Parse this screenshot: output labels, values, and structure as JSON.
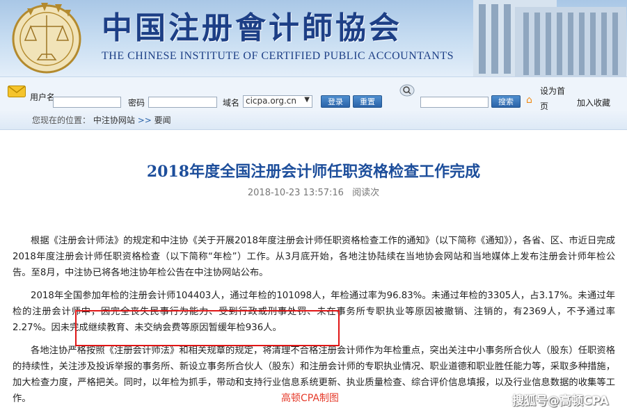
{
  "header": {
    "title_cn": "中国注册會计師協会",
    "title_en": "THE CHINESE INSTITUTE OF CERTIFIED PUBLIC ACCOUNTANTS"
  },
  "toolbar": {
    "username_label": "用户名",
    "username_value": "",
    "password_label": "密码",
    "password_value": "",
    "domain_label": "域名",
    "domain_value": "cicpa.org.cn",
    "login_label": "登录",
    "reset_label": "重置",
    "search_value": "",
    "search_label": "搜索",
    "homepage_label": "设为首页",
    "favorite_label": "加入收藏"
  },
  "breadcrumb": {
    "prefix": "您现在的位置：",
    "site": "中注协网站",
    "separator": ">>",
    "current": "要闻"
  },
  "article": {
    "title": "2018年度全国注册会计师任职资格检查工作完成",
    "datetime": "2018-10-23 13:57:16",
    "views_label": "阅读次",
    "para1": "根据《注册会计师法》的规定和中注协《关于开展2018年度注册会计师任职资格检查工作的通知》（以下简称《通知》），各省、区、市近日完成2018年度注册会计师任职资格检查（以下简称“年检”）工作。从3月底开始，各地注协陆续在当地协会网站和当地媒体上发布注册会计师年检公告。至8月，中注协已将各地注协年检公告在中注协网站公布。",
    "para2": "2018年全国参加年检的注册会计师104403人，通过年检的101098人，年检通过率为96.83%。未通过年检的3305人，占3.17%。未通过年检的注册会计师中，因完全丧失民事行为能力、受到行政或刑事处罚、未在事务所专职执业等原因被撤销、注销的，有2369人，不予通过率2.27%。因未完成继续教育、未交纳会费等原因暂缓年检936人。",
    "para3": "各地注协严格按照《注册会计师法》和相关规章的规定，将清理不合格注册会计师作为年检重点，突出关注中小事务所合伙人（股东）任职资格的持续性，关注涉及投诉举报的事务所、新设立事务所合伙人（股东）和注册会计师的专职执业情况、职业道德和职业胜任能力等，采取多种措施，加大检查力度，严格把关。同时，以年检为抓手，带动和支持行业信息系统更新、执业质量检查、综合评价信息填报，以及行业信息数据的收集等工作。"
  },
  "overlay": {
    "caption": "高顿CPA制图",
    "watermark": "搜狐号@高顿CPA"
  },
  "colors": {
    "title_blue": "#1d4e9b",
    "highlight_red": "#e01515",
    "caption_red": "#e53a2a"
  }
}
